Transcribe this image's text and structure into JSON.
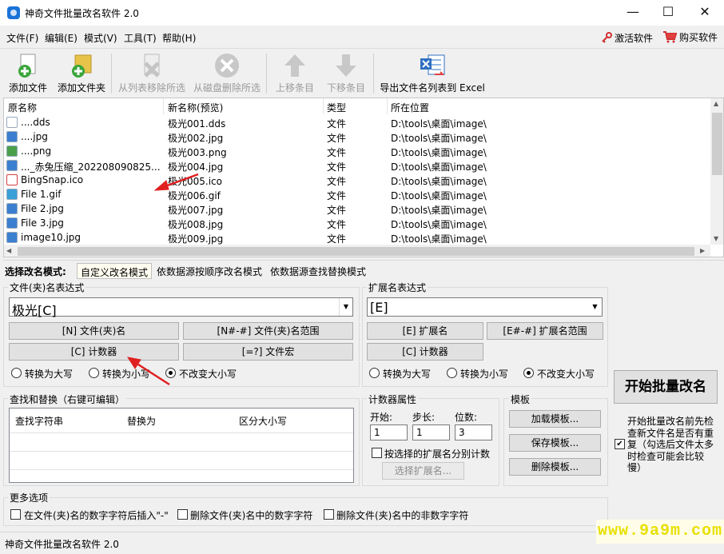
{
  "window": {
    "title": "神奇文件批量改名软件 2.0",
    "minimize": "—",
    "maximize": "☐",
    "close": "✕"
  },
  "menu": [
    "文件(F)",
    "编辑(E)",
    "模式(V)",
    "工具(T)",
    "帮助(H)"
  ],
  "header_links": {
    "activate": "激活软件",
    "buy": "购买软件"
  },
  "toolbar": {
    "add_file": "添加文件",
    "add_folder": "添加文件夹",
    "remove_from_list": "从列表移除所选",
    "delete_from_disk": "从磁盘删除所选",
    "move_up": "上移条目",
    "move_down": "下移条目",
    "export_excel": "导出文件名列表到 Excel"
  },
  "file_list": {
    "columns": [
      "原名称",
      "新名称(预览)",
      "类型",
      "所在位置"
    ],
    "rows": [
      {
        "icon": "doc",
        "original": "....dds",
        "new": "极光001.dds",
        "type": "文件",
        "location": "D:\\tools\\桌面\\image\\"
      },
      {
        "icon": "jpg",
        "original": "....jpg",
        "new": "极光002.jpg",
        "type": "文件",
        "location": "D:\\tools\\桌面\\image\\"
      },
      {
        "icon": "png",
        "original": "....png",
        "new": "极光003.png",
        "type": "文件",
        "location": "D:\\tools\\桌面\\image\\"
      },
      {
        "icon": "jpg",
        "original": "..._赤兔压缩_202208090825...",
        "new": "极光004.jpg",
        "type": "文件",
        "location": "D:\\tools\\桌面\\image\\"
      },
      {
        "icon": "ico",
        "original": "BingSnap.ico",
        "new": "极光005.ico",
        "type": "文件",
        "location": "D:\\tools\\桌面\\image\\"
      },
      {
        "icon": "gif",
        "original": "File 1.gif",
        "new": "极光006.gif",
        "type": "文件",
        "location": "D:\\tools\\桌面\\image\\"
      },
      {
        "icon": "jpg",
        "original": "File 2.jpg",
        "new": "极光007.jpg",
        "type": "文件",
        "location": "D:\\tools\\桌面\\image\\"
      },
      {
        "icon": "jpg",
        "original": "File 3.jpg",
        "new": "极光008.jpg",
        "type": "文件",
        "location": "D:\\tools\\桌面\\image\\"
      },
      {
        "icon": "jpg",
        "original": "image10.jpg",
        "new": "极光009.jpg",
        "type": "文件",
        "location": "D:\\tools\\桌面\\image\\"
      }
    ]
  },
  "mode": {
    "label": "选择改名模式:",
    "tabs": [
      "自定义改名模式",
      "依数据源按顺序改名模式",
      "依数据源查找替换模式"
    ],
    "active": 0
  },
  "name_expr": {
    "title": "文件(夹)名表达式",
    "value": "极光[C]",
    "buttons": [
      "[N] 文件(夹)名",
      "[N#-#] 文件(夹)名范围",
      "[C] 计数器",
      "[=?] 文件宏"
    ],
    "case_options": [
      "转换为大写",
      "转换为小写",
      "不改变大小写"
    ],
    "selected_case": 2
  },
  "ext_expr": {
    "title": "扩展名表达式",
    "value": "[E]",
    "buttons": [
      "[E] 扩展名",
      "[E#-#] 扩展名范围",
      "[C] 计数器"
    ],
    "case_options": [
      "转换为大写",
      "转换为小写",
      "不改变大小写"
    ],
    "selected_case": 2
  },
  "find_replace": {
    "title": "查找和替换（右键可编辑）",
    "columns": [
      "查找字符串",
      "替换为",
      "区分大小写"
    ]
  },
  "counter": {
    "title": "计数器属性",
    "start_label": "开始:",
    "start": "1",
    "step_label": "步长:",
    "step": "1",
    "digits_label": "位数:",
    "digits": "3",
    "by_ext_label": "按选择的扩展名分别计数",
    "select_ext_button": "选择扩展名..."
  },
  "template": {
    "title": "模板",
    "buttons": [
      "加载模板...",
      "保存模板...",
      "删除模板..."
    ]
  },
  "start_button": "开始批量改名",
  "check_duplicates": {
    "checked": true,
    "text": "开始批量改名前先检查新文件名是否有重复（勾选后文件太多时检查可能会比较慢）",
    "lines": [
      "开始批量改名前先检",
      "查新文件名是否有重",
      "复（勾选后文件太多",
      "时检查可能会比较",
      "慢）"
    ]
  },
  "more_options": {
    "title": "更多选项",
    "options": [
      "在文件(夹)名的数字字符后插入\"-\"",
      "删除文件(夹)名中的数字字符",
      "删除文件(夹)名中的非数字字符"
    ]
  },
  "status": "神奇文件批量改名软件 2.0",
  "watermark": "www.9a9m.com",
  "colors": {
    "arrow": "#e02020",
    "jpg_icon": "#3b7fd1",
    "png_icon": "#4aa04a",
    "gif_icon": "#3aa0d8"
  }
}
